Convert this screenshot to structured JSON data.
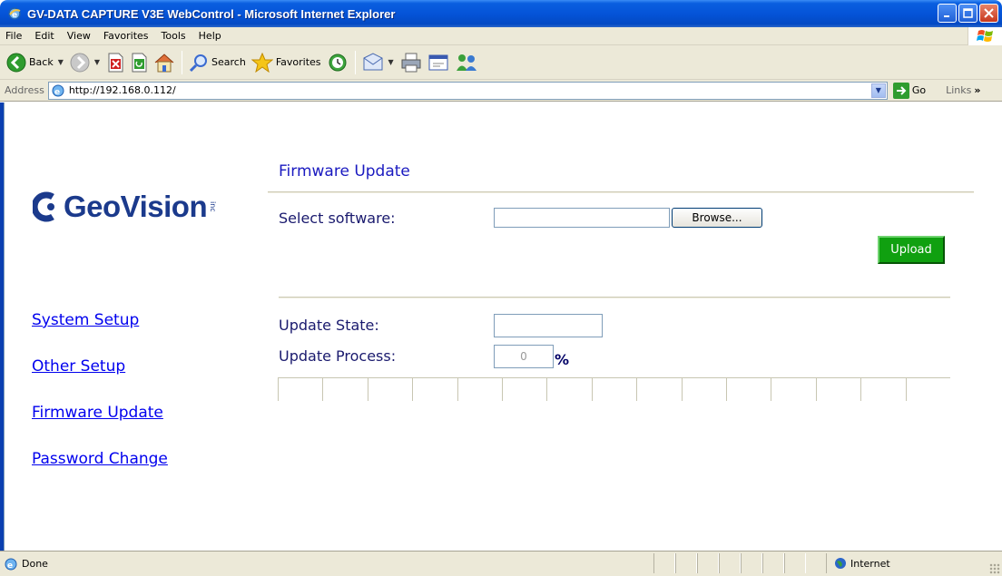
{
  "window": {
    "title": "GV-DATA CAPTURE V3E WebControl - Microsoft Internet Explorer"
  },
  "menu": [
    "File",
    "Edit",
    "View",
    "Favorites",
    "Tools",
    "Help"
  ],
  "toolbar": {
    "back_label": "Back",
    "search_label": "Search",
    "favorites_label": "Favorites"
  },
  "address": {
    "label": "Address",
    "url": "http://192.168.0.112/",
    "go_label": "Go",
    "links_label": "Links"
  },
  "logo": {
    "brand": "GeoVision",
    "suffix": "inc"
  },
  "nav": [
    {
      "label": "System Setup"
    },
    {
      "label": "Other Setup"
    },
    {
      "label": "Firmware Update"
    },
    {
      "label": "Password Change"
    }
  ],
  "form": {
    "title": "Firmware Update",
    "select_label": "Select software:",
    "file_value": "",
    "browse_label": "Browse...",
    "upload_label": "Upload",
    "state_label": "Update State:",
    "state_value": "",
    "process_label": "Update Process:",
    "process_value": "0",
    "percent_sign": "%",
    "progress_fraction": 0,
    "progress_segments": 15
  },
  "status": {
    "text": "Done",
    "zone": "Internet"
  },
  "colors": {
    "title_blue": "#1a1ac0",
    "link": "#0000ee",
    "upload_green": "#10a010",
    "xp_blue": "#0554d8"
  }
}
